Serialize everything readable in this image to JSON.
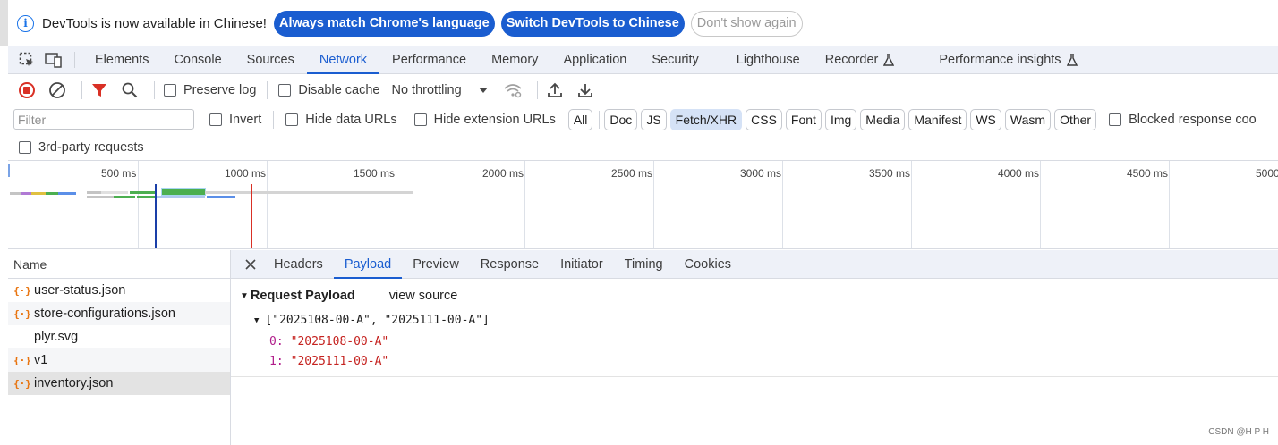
{
  "infobar": {
    "message": "DevTools is now available in Chinese!",
    "buttons": [
      "Always match Chrome's language",
      "Switch DevTools to Chinese",
      "Don't show again"
    ]
  },
  "main_tabs": [
    "Elements",
    "Console",
    "Sources",
    "Network",
    "Performance",
    "Memory",
    "Application",
    "Security",
    "Lighthouse",
    "Recorder",
    "Performance insights"
  ],
  "active_main_tab": "Network",
  "toolbar": {
    "preserve_log": "Preserve log",
    "disable_cache": "Disable cache",
    "throttling": "No throttling"
  },
  "filter": {
    "placeholder": "Filter",
    "invert": "Invert",
    "hide_data_urls": "Hide data URLs",
    "hide_extension_urls": "Hide extension URLs",
    "types": [
      "All",
      "Doc",
      "JS",
      "Fetch/XHR",
      "CSS",
      "Font",
      "Img",
      "Media",
      "Manifest",
      "WS",
      "Wasm",
      "Other"
    ],
    "active_type": "Fetch/XHR",
    "blocked": "Blocked response coo",
    "third_party": "3rd-party requests"
  },
  "overview_ticks": [
    "500 ms",
    "1000 ms",
    "1500 ms",
    "2000 ms",
    "2500 ms",
    "3000 ms",
    "3500 ms",
    "4000 ms",
    "4500 ms",
    "5000"
  ],
  "requests": {
    "header": "Name",
    "items": [
      {
        "name": "user-status.json",
        "icon": "fetch-icon"
      },
      {
        "name": "store-configurations.json",
        "icon": "fetch-icon"
      },
      {
        "name": "plyr.svg",
        "icon": ""
      },
      {
        "name": "v1",
        "icon": "fetch-icon"
      },
      {
        "name": "inventory.json",
        "icon": "fetch-icon"
      }
    ],
    "selected": "inventory.json"
  },
  "detail": {
    "tabs": [
      "Headers",
      "Payload",
      "Preview",
      "Response",
      "Initiator",
      "Timing",
      "Cookies"
    ],
    "active_tab": "Payload",
    "payload_title": "Request Payload",
    "view_source": "view source",
    "array_summary": "[\"2025108-00-A\", \"2025111-00-A\"]",
    "items": [
      {
        "index": "0:",
        "value": "\"2025108-00-A\""
      },
      {
        "index": "1:",
        "value": "\"2025111-00-A\""
      }
    ]
  },
  "watermark": "CSDN @H P H",
  "colors": {
    "accent": "#1a5dd0",
    "record_red": "#d93025",
    "filter_red": "#d93025",
    "js_icon": "#e8710a"
  }
}
